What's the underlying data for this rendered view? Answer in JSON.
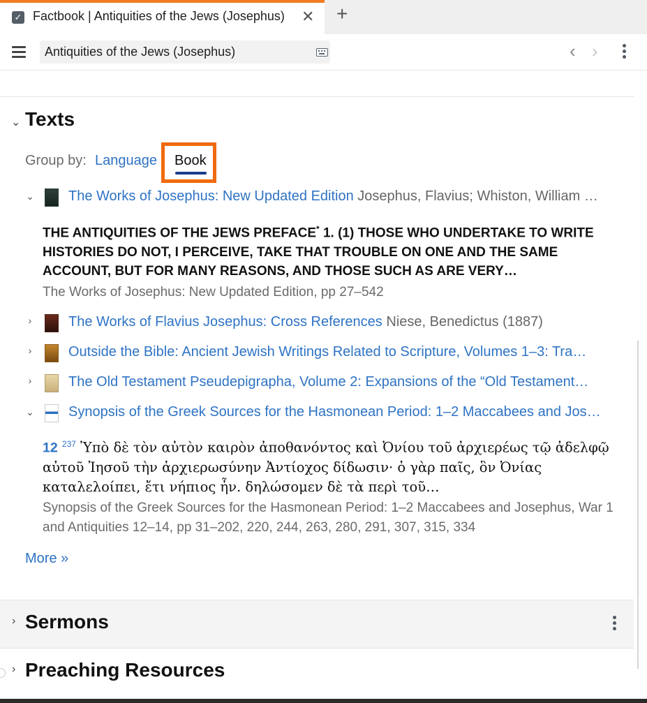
{
  "tab": {
    "title": "Factbook | Antiquities of the Jews (Josephus)",
    "close_glyph": "✕",
    "add_glyph": "+",
    "accent_color": "#f07b22"
  },
  "toolbar": {
    "search_value": "Antiquities of the Jews (Josephus)",
    "back_glyph": "‹",
    "forward_glyph": "›"
  },
  "texts_section": {
    "title": "Texts",
    "group_by_label": "Group by:",
    "group_options": [
      "Language",
      "Book"
    ],
    "selected_group": "Book",
    "books": [
      {
        "title": "The Works of Josephus: New Updated Edition",
        "author": "Josephus, Flavius; Whiston, William …",
        "expanded": true,
        "snippet": "THE ANTIQUITIES OF THE JEWS PREFACE",
        "snippet_marker": "*",
        "snippet_rest": " 1. (1) THOSE WHO UNDERTAKE TO WRITE HISTORIES DO NOT, I PERCEIVE, TAKE THAT TROUBLE ON ONE AND THE SAME ACCOUNT, BUT FOR MANY REASONS, AND THOSE SUCH AS ARE VERY…",
        "citation": "The Works of Josephus: New Updated Edition, pp 27–542"
      },
      {
        "title": "The Works of Flavius Josephus: Cross References",
        "author": "Niese, Benedictus (1887)",
        "expanded": false
      },
      {
        "title": "Outside the Bible: Ancient Jewish Writings Related to Scripture, Volumes 1–3: Tra…",
        "author": "",
        "expanded": false
      },
      {
        "title": "The Old Testament Pseudepigrapha, Volume 2: Expansions of the “Old Testament…",
        "author": "",
        "expanded": false
      },
      {
        "title": "Synopsis of the Greek Sources for the Hasmonean Period: 1–2 Maccabees and Jos…",
        "author": "",
        "expanded": true,
        "snippet_number": "12",
        "snippet_sup": "237",
        "snippet": "Ὑπὸ δὲ τὸν αὐτὸν καιρὸν ἀποθανόντος καὶ Ὀνίου τοῦ ἀρχιερέως τῷ ἀδελφῷ αὐτοῦ Ἰησοῦ τὴν ἀρχιερωσύνην Ἀντίοχος δίδωσιν· ὁ γὰρ παῖς, ὃν Ὀνίας καταλελοίπει, ἔτι νήπιος ἦν. δηλώσομεν δὲ τὰ περὶ τοῦ…",
        "citation": "Synopsis of the Greek Sources for the Hasmonean Period: 1–2 Maccabees and Josephus, War 1 and Antiquities 12–14, pp 31–202, 220, 244, 263, 280, 291, 307, 315, 334"
      }
    ],
    "more_link": "More »"
  },
  "sermons_section": {
    "title": "Sermons"
  },
  "preaching_section": {
    "title": "Preaching Resources"
  },
  "colors": {
    "link": "#2e73c4",
    "highlight_frame": "#f06a0d",
    "selected_underline": "#1d3e8a"
  },
  "icons": {
    "tab": "checkbox-icon",
    "menu": "hamburger-icon",
    "keyboard": "keyboard-icon",
    "more": "kebab-icon"
  }
}
